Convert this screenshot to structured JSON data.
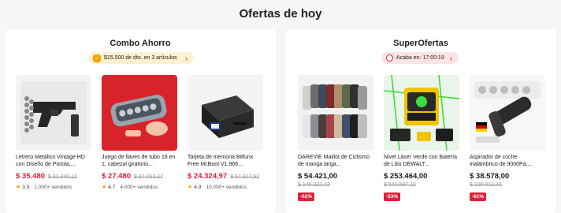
{
  "page_title": "Ofertas de hoy",
  "combo": {
    "title": "Combo Ahorro",
    "pill_text": "$15.500 de dto. en 3 artículos",
    "pill_icon": "tag-icon",
    "products": [
      {
        "name": "Letrero Metálico Vintage HD con Diseño de Pistola,...",
        "price": "$ 35.480",
        "old_price": "$ 81.340,12",
        "rating": "3.5",
        "sold": "1.000+ vendidos"
      },
      {
        "name": "Juego de llaves de tubo 16 en 1, cabezal giratorio...",
        "price": "$ 27.480",
        "old_price": "$ 67.653,37",
        "rating": "4.7",
        "sold": "4.000+ vendidos"
      },
      {
        "name": "Tarjeta de memoria Bitfunx Free McBoot V1.966...",
        "price": "$ 24.324,97",
        "old_price": "$ 57.917,52",
        "rating": "4.9",
        "sold": "10.000+ vendidos"
      }
    ]
  },
  "super": {
    "title": "SuperOfertas",
    "pill_text": "Acaba en: 17:00:19",
    "pill_icon": "clock-icon",
    "products": [
      {
        "name": "DAREVIE Maillot de Ciclismo de manga larga...",
        "price": "$ 54.421,00",
        "old_price": "$ 146.332,42",
        "discount": "-62%"
      },
      {
        "name": "Nivel Láser Verde con Batería de Litio DEWALT...",
        "price": "$ 253.464,00",
        "old_price": "$ 540.597,12",
        "discount": "-53%"
      },
      {
        "name": "Aspirador de coche inalámbrico de 9000Pa,...",
        "price": "$ 38.578,00",
        "old_price": "$ 100.013,16",
        "discount": "-61%"
      }
    ]
  },
  "colors": {
    "accent": "#e0203b",
    "star": "#f5a300",
    "pill_yellow": "#fdf1cf",
    "pill_pink": "#fde4e4"
  }
}
